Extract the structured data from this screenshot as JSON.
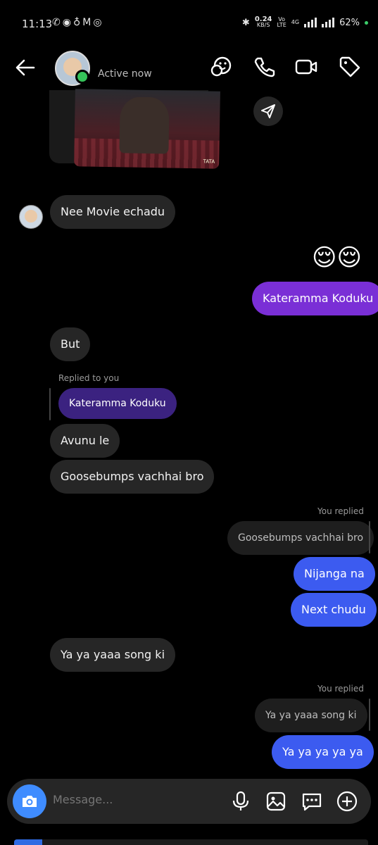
{
  "status_bar": {
    "time": "11:13",
    "speed_value": "0.24",
    "speed_unit": "KB/S",
    "volte_top": "Vo",
    "volte_bottom": "LTE",
    "network": "4G",
    "battery": "62%"
  },
  "header": {
    "status": "Active now"
  },
  "messages": {
    "m1": "Nee Movie echadu",
    "emoji": "😌😌",
    "m2": "Kateramma Koduku",
    "m3": "But",
    "reply_label_1": "Replied to you",
    "reply_quote_1": "Kateramma Koduku",
    "m4": "Avunu le",
    "m5": "Goosebumps vachhai bro",
    "you_replied_1": "You replied",
    "reply_quote_2": "Goosebumps vachhai bro",
    "m6": "Nijanga na",
    "m7": "Next chudu",
    "m8": "Ya ya yaaa song ki",
    "you_replied_2": "You replied",
    "reply_quote_3": "Ya ya yaaa song ki",
    "m9": "Ya ya ya ya ya"
  },
  "composer": {
    "placeholder": "Message..."
  },
  "colors": {
    "sent_purple": "#7a2fd6",
    "sent_blue": "#3c5bf0",
    "received": "#262626",
    "camera_button": "#3f8cff",
    "online_dot": "#35c35a"
  }
}
